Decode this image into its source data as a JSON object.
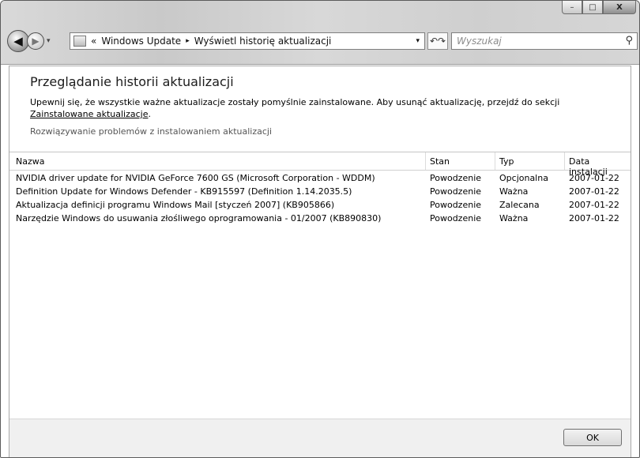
{
  "window": {
    "caption_buttons": {
      "minimize": "–",
      "maximize": "□",
      "close": "X"
    }
  },
  "nav": {
    "back_icon": "back-arrow-icon",
    "forward_icon": "forward-arrow-icon",
    "history_dropdown": "▾",
    "address_chevron": "«",
    "breadcrumb": [
      "Windows Update",
      "Wyświetl historię aktualizacji"
    ],
    "breadcrumb_sep": "▸",
    "address_dropdown": "▾",
    "refresh_glyph": "↶↷",
    "search_placeholder": "Wyszukaj",
    "search_icon_glyph": "⚲"
  },
  "main": {
    "title": "Przeglądanie historii aktualizacji",
    "desc_text": "Upewnij się, że wszystkie ważne aktualizacje zostały pomyślnie zainstalowane. Aby usunąć aktualizację, przejdź do sekcji ",
    "desc_link": "Zainstalowane aktualizacje",
    "desc_end": ".",
    "troubleshoot_link": "Rozwiązywanie problemów z instalowaniem aktualizacji"
  },
  "table": {
    "columns": [
      "Nazwa",
      "Stan",
      "Typ",
      "Data instalacji"
    ],
    "rows": [
      [
        "NVIDIA driver update for NVIDIA GeForce 7600 GS (Microsoft Corporation - WDDM)",
        "Powodzenie",
        "Opcjonalna",
        "2007-01-22"
      ],
      [
        "Definition Update for Windows Defender - KB915597 (Definition 1.14.2035.5)",
        "Powodzenie",
        "Ważna",
        "2007-01-22"
      ],
      [
        "Aktualizacja definicji programu Windows Mail [styczeń 2007] (KB905866)",
        "Powodzenie",
        "Zalecana",
        "2007-01-22"
      ],
      [
        "Narzędzie Windows do usuwania złośliwego oprogramowania - 01/2007 (KB890830)",
        "Powodzenie",
        "Ważna",
        "2007-01-22"
      ]
    ]
  },
  "footer": {
    "ok_label": "OK"
  }
}
